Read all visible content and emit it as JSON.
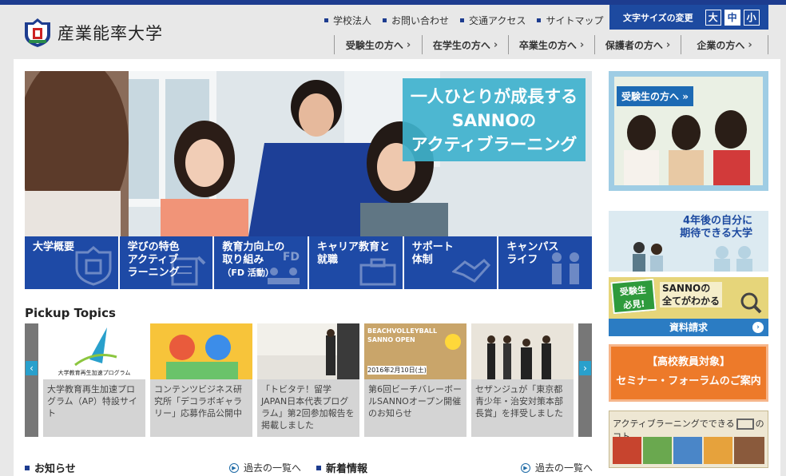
{
  "site": {
    "name": "産業能率大学"
  },
  "util_links": [
    {
      "label": "学校法人"
    },
    {
      "label": "お問い合わせ"
    },
    {
      "label": "交通アクセス"
    },
    {
      "label": "サイトマップ"
    }
  ],
  "font_size": {
    "label": "文字サイズの変更",
    "large": "大",
    "medium": "中",
    "small": "小",
    "selected": "中"
  },
  "global_nav": [
    {
      "label": "受験生の方へ"
    },
    {
      "label": "在学生の方へ"
    },
    {
      "label": "卒業生の方へ"
    },
    {
      "label": "保護者の方へ"
    },
    {
      "label": "企業の方へ"
    }
  ],
  "hero": {
    "catch_line1": "一人ひとりが成長する",
    "catch_line2": "SANNOの",
    "catch_line3": "アクティブラーニング"
  },
  "feature_nav": [
    {
      "line1": "大学概要",
      "line2": "",
      "line3": ""
    },
    {
      "line1": "学びの特色",
      "line2": "アクティブ",
      "line3": "ラーニング"
    },
    {
      "line1": "教育力向上の",
      "line2": "取り組み",
      "line3": "（FD 活動）",
      "badge": "FD"
    },
    {
      "line1": "キャリア教育と",
      "line2": "就職",
      "line3": ""
    },
    {
      "line1": "サポート",
      "line2": "体制",
      "line3": ""
    },
    {
      "line1": "キャンパス",
      "line2": "ライフ",
      "line3": ""
    }
  ],
  "pickup": {
    "title": "Pickup Topics",
    "items": [
      {
        "text": "大学教育再生加速プログラム（AP）特設サイト",
        "img_caption": "大学教育再生加速プログラム"
      },
      {
        "text": "コンテンツビジネス研究所「デコラボギャラリー」応募作品公開中"
      },
      {
        "text": "「トビタテ！留学JAPAN日本代表プログラム」第2回参加報告を掲載しました"
      },
      {
        "text": "第6回ビーチバレーボールSANNOオープン開催のお知らせ",
        "img_caption1": "BEACHVOLLEYBALL",
        "img_caption2": "SANNO OPEN",
        "img_caption3": "2016年2月10日(土)"
      },
      {
        "text": "セザンジュが「東京都青少年・治安対策本部長賞」を拝受しました"
      }
    ]
  },
  "news": {
    "notice_title": "お知らせ",
    "notice_more": "過去の一覧へ",
    "new_title": "新着情報",
    "new_more": "過去の一覧へ"
  },
  "sidebar": {
    "applicant_tag": "受験生の方へ",
    "future_line1": "4年後の自分に",
    "future_line2": "期待できる大学",
    "request_badge1": "受験生",
    "request_badge2": "必見!",
    "request_text1": "SANNOの",
    "request_text2": "全てがわかる",
    "request_bar": "資料請求",
    "seminar_line1": "【高校教員対象】",
    "seminar_line2": "セミナー・フォーラムのご案内",
    "al_title": "アクティブラーニングでできる",
    "al_suffix": "のコト"
  },
  "colors": {
    "brand": "#1d3c8f",
    "feature": "#1e4aa6",
    "catch": "#3fb2cd",
    "seminar": "#ed7a2a"
  }
}
